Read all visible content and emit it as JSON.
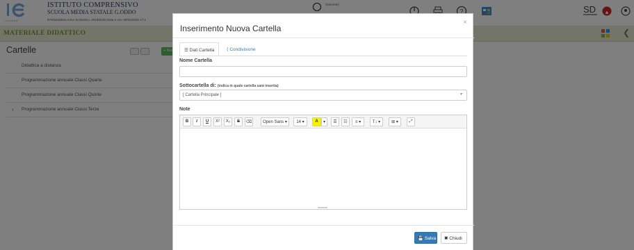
{
  "header": {
    "logo_text": "i i e n d s e",
    "school_name": "ISTITUTO COMPRENSIVO",
    "school_sub": "SCUOLA MEDIA STATALE G.ODDO",
    "school_meta": "87001510822    Anno Scolastico: 2019/2020   Data e ora: 09/03/2020 17:1",
    "user_role": "(Docente)",
    "section_title": "MATERIALE DIDATTICO",
    "sd_logo": "SD"
  },
  "sidebar": {
    "title": "Cartelle",
    "new_button": "+ Nuova",
    "folders": [
      {
        "label": "Didattica a distanza",
        "expandable": false
      },
      {
        "label": "Programmazione annuale Classi Quarte",
        "expandable": false
      },
      {
        "label": "Programmazione annuale Classi Quinte",
        "expandable": false
      },
      {
        "label": "Programmazione annuale Classi Terze",
        "expandable": true,
        "chevron": "›"
      }
    ]
  },
  "modal": {
    "title": "Inserimento Nuova Cartella",
    "close": "×",
    "tabs": [
      {
        "label": "Dati Cartella",
        "icon": "list-icon",
        "active": true
      },
      {
        "label": "Condivisione",
        "icon": "share-icon",
        "active": false
      }
    ],
    "name_label": "Nome Cartella",
    "name_value": "",
    "parent_label": "Sottocartella di:",
    "parent_hint": "(indica in quale cartella sarà inserita)",
    "parent_value": "[ Cartella Principale ]",
    "notes_label": "Note",
    "toolbar": {
      "bold": "B",
      "italic": "I",
      "underline": "U",
      "superscript": "X²",
      "subscript": "X₂",
      "strikethrough": "S",
      "eraser": "⌫",
      "font_family": "Open Sans ▾",
      "font_size": "14 ▾",
      "color": "A",
      "color_dropdown": "▾",
      "bullet_list": "☰",
      "ordered_list": "☷",
      "paragraph": "≡ ▾",
      "line_height": "T↕ ▾",
      "table": "⊞ ▾",
      "fullscreen": "⤢"
    },
    "save_label": "Salva",
    "close_label": "Chiudi"
  },
  "colors": {
    "accent_blue": "#337ab7",
    "section_green": "#6e9f2a",
    "add_green": "#5cb85c",
    "highlight_yellow": "#f4f400"
  }
}
